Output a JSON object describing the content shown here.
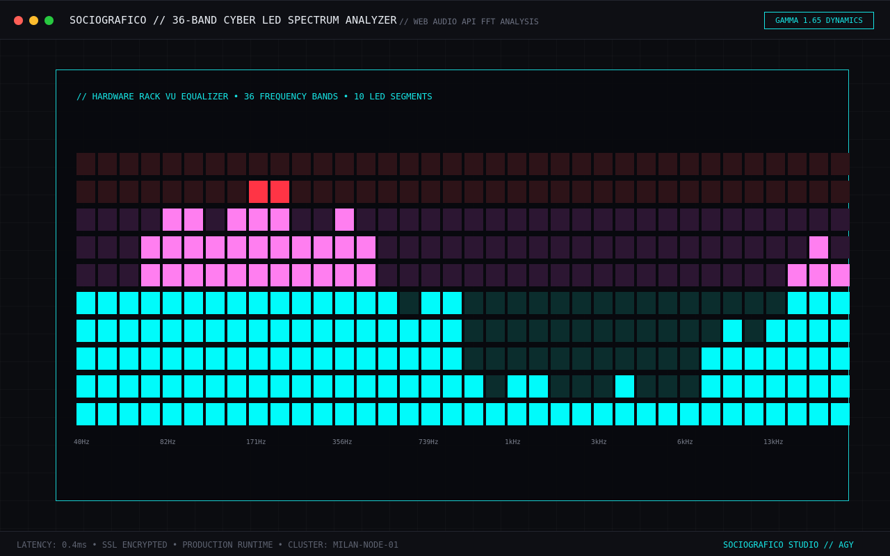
{
  "window": {
    "title": "SOCIOGRAFICO // 36-BAND CYBER LED SPECTRUM ANALYZER",
    "subtitle": "// WEB AUDIO API FFT ANALYSIS",
    "badge": "GAMMA 1.65 DYNAMICS",
    "controls": [
      "close",
      "minimize",
      "maximize"
    ]
  },
  "panel": {
    "caption": "// HARDWARE RACK VU EQUALIZER • 36 FREQUENCY BANDS • 10 LED SEGMENTS"
  },
  "colors": {
    "low_on": "#00fbfb",
    "low_off": "#0b2d2d",
    "mid_on": "#ff7ef0",
    "mid_off": "#2c1632",
    "peak_on": "#ff3445",
    "peak_off": "#2d1318",
    "accent": "#16e3e3"
  },
  "spectrum": {
    "bands": 36,
    "segments": 10,
    "segment_colors": [
      "low",
      "low",
      "low",
      "low",
      "low",
      "mid",
      "mid",
      "mid",
      "peak",
      "peak"
    ],
    "levels": [
      6,
      5,
      5,
      7,
      8,
      7,
      7,
      8,
      9,
      9,
      7,
      7,
      8,
      7,
      5,
      4,
      5,
      5,
      2,
      1,
      2,
      2,
      1,
      1,
      1,
      2,
      1,
      1,
      1,
      3,
      4,
      3,
      4,
      5,
      7,
      6
    ],
    "lit": [
      [
        1,
        1,
        1,
        1,
        1,
        0,
        0,
        0,
        0,
        0
      ],
      [
        1,
        1,
        1,
        1,
        1,
        0,
        0,
        0,
        0,
        0
      ],
      [
        1,
        1,
        1,
        1,
        1,
        0,
        0,
        0,
        0,
        0
      ],
      [
        1,
        1,
        1,
        1,
        1,
        1,
        1,
        0,
        0,
        0
      ],
      [
        1,
        1,
        1,
        1,
        1,
        1,
        1,
        1,
        0,
        0
      ],
      [
        1,
        1,
        1,
        1,
        1,
        1,
        1,
        1,
        0,
        0
      ],
      [
        1,
        1,
        1,
        1,
        1,
        1,
        1,
        0,
        0,
        0
      ],
      [
        1,
        1,
        1,
        1,
        1,
        1,
        1,
        1,
        0,
        0
      ],
      [
        1,
        1,
        1,
        1,
        1,
        1,
        1,
        1,
        1,
        0
      ],
      [
        1,
        1,
        1,
        1,
        1,
        1,
        1,
        1,
        1,
        0
      ],
      [
        1,
        1,
        1,
        1,
        1,
        1,
        1,
        0,
        0,
        0
      ],
      [
        1,
        1,
        1,
        1,
        1,
        1,
        1,
        0,
        0,
        0
      ],
      [
        1,
        1,
        1,
        1,
        1,
        1,
        1,
        1,
        0,
        0
      ],
      [
        1,
        1,
        1,
        1,
        1,
        1,
        1,
        0,
        0,
        0
      ],
      [
        1,
        1,
        1,
        1,
        1,
        0,
        0,
        0,
        0,
        0
      ],
      [
        1,
        1,
        1,
        1,
        0,
        0,
        0,
        0,
        0,
        0
      ],
      [
        1,
        1,
        1,
        1,
        1,
        0,
        0,
        0,
        0,
        0
      ],
      [
        1,
        1,
        1,
        1,
        1,
        0,
        0,
        0,
        0,
        0
      ],
      [
        1,
        1,
        0,
        0,
        0,
        0,
        0,
        0,
        0,
        0
      ],
      [
        1,
        0,
        0,
        0,
        0,
        0,
        0,
        0,
        0,
        0
      ],
      [
        1,
        1,
        0,
        0,
        0,
        0,
        0,
        0,
        0,
        0
      ],
      [
        1,
        1,
        0,
        0,
        0,
        0,
        0,
        0,
        0,
        0
      ],
      [
        1,
        0,
        0,
        0,
        0,
        0,
        0,
        0,
        0,
        0
      ],
      [
        1,
        0,
        0,
        0,
        0,
        0,
        0,
        0,
        0,
        0
      ],
      [
        1,
        0,
        0,
        0,
        0,
        0,
        0,
        0,
        0,
        0
      ],
      [
        1,
        1,
        0,
        0,
        0,
        0,
        0,
        0,
        0,
        0
      ],
      [
        1,
        0,
        0,
        0,
        0,
        0,
        0,
        0,
        0,
        0
      ],
      [
        1,
        0,
        0,
        0,
        0,
        0,
        0,
        0,
        0,
        0
      ],
      [
        1,
        0,
        0,
        0,
        0,
        0,
        0,
        0,
        0,
        0
      ],
      [
        1,
        1,
        1,
        0,
        0,
        0,
        0,
        0,
        0,
        0
      ],
      [
        1,
        1,
        1,
        1,
        0,
        0,
        0,
        0,
        0,
        0
      ],
      [
        1,
        1,
        1,
        0,
        0,
        0,
        0,
        0,
        0,
        0
      ],
      [
        1,
        1,
        1,
        1,
        0,
        0,
        0,
        0,
        0,
        0
      ],
      [
        1,
        1,
        1,
        1,
        1,
        1,
        0,
        0,
        0,
        0
      ],
      [
        1,
        1,
        1,
        1,
        1,
        1,
        1,
        0,
        0,
        0
      ],
      [
        1,
        1,
        1,
        1,
        1,
        1,
        0,
        0,
        0,
        0
      ]
    ],
    "freq_labels": [
      "40Hz",
      "82Hz",
      "171Hz",
      "356Hz",
      "739Hz",
      "1kHz",
      "3kHz",
      "6kHz",
      "13kHz"
    ],
    "label_band_indices": [
      0,
      4,
      8,
      12,
      16,
      20,
      24,
      28,
      32
    ]
  },
  "footer": {
    "status": "LATENCY: 0.4ms • SSL ENCRYPTED • PRODUCTION RUNTIME • CLUSTER: MILAN-NODE-01",
    "brand": "SOCIOGRAFICO STUDIO // AGY"
  }
}
